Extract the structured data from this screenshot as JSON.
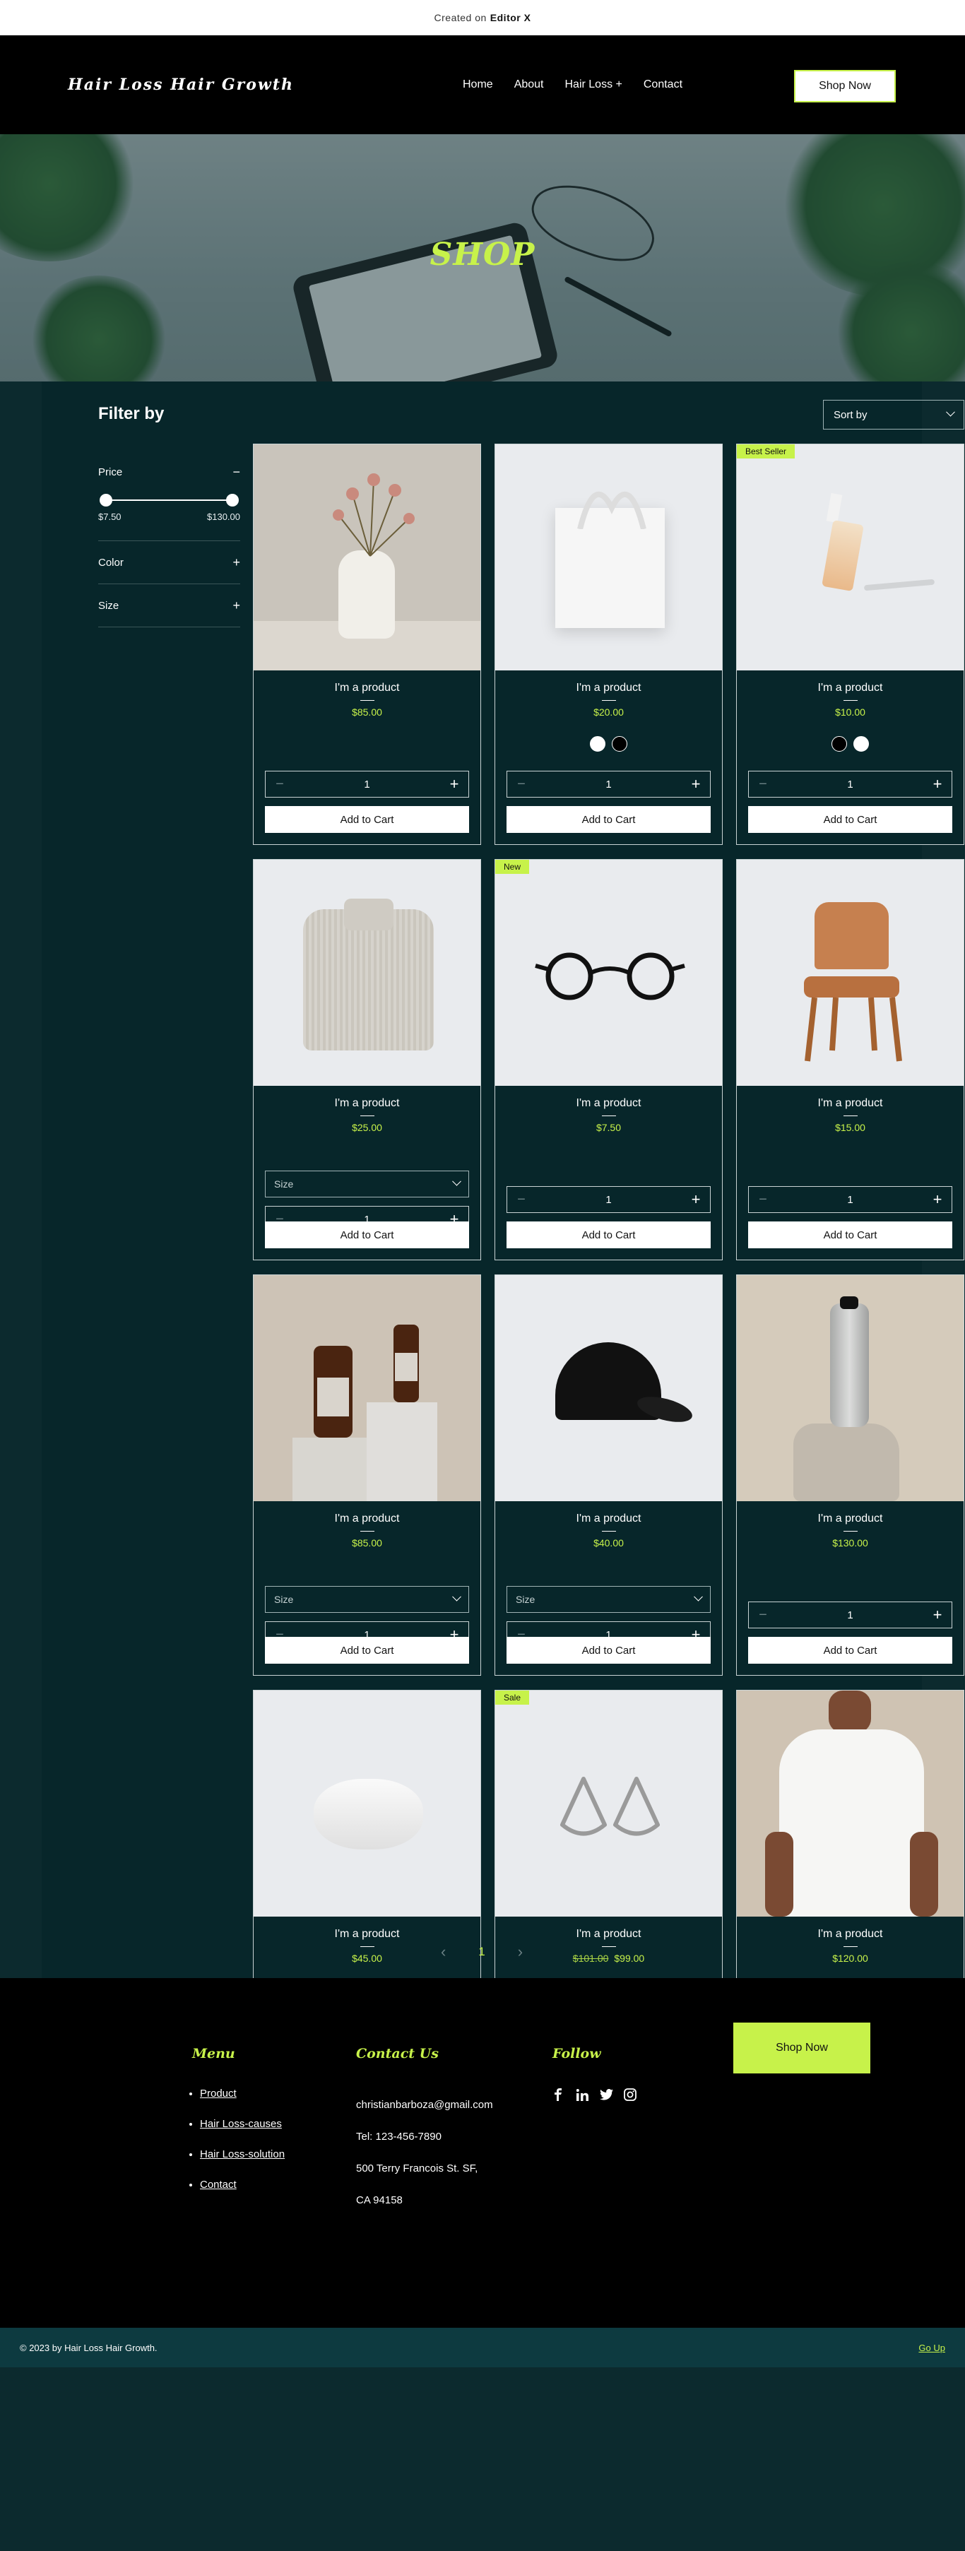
{
  "banner": {
    "prefix": "Created on",
    "brand": "Editor X"
  },
  "header": {
    "logo": "Hair Loss Hair Growth",
    "nav": [
      "Home",
      "About",
      "Hair Loss +",
      "Contact"
    ],
    "cta": "Shop Now"
  },
  "hero": {
    "title": "SHOP"
  },
  "filters": {
    "title": "Filter by",
    "price": {
      "label": "Price",
      "min": "$7.50",
      "max": "$130.00",
      "toggle": "−"
    },
    "color": {
      "label": "Color",
      "toggle": "+"
    },
    "size": {
      "label": "Size",
      "toggle": "+"
    }
  },
  "sort": {
    "label": "Sort by"
  },
  "product_common": {
    "qty": "1",
    "add_to_cart": "Add to Cart",
    "size_placeholder": "Size"
  },
  "products": [
    {
      "name": "I'm a product",
      "price": "$85.00",
      "ribbon": "",
      "variant": "none",
      "image": "vase-flowers"
    },
    {
      "name": "I'm a product",
      "price": "$20.00",
      "ribbon": "",
      "variant": "color",
      "image": "tote-bag",
      "swatches": [
        "#ffffff",
        "#000000"
      ]
    },
    {
      "name": "I'm a product",
      "price": "$10.00",
      "ribbon": "Best Seller",
      "variant": "color",
      "image": "serum-bottle",
      "swatches": [
        "#000000",
        "#ffffff"
      ]
    },
    {
      "name": "I'm a product",
      "price": "$25.00",
      "ribbon": "",
      "variant": "size",
      "image": "knit-sweater"
    },
    {
      "name": "I'm a product",
      "price": "$7.50",
      "ribbon": "New",
      "variant": "none",
      "image": "eyeglasses"
    },
    {
      "name": "I'm a product",
      "price": "$15.00",
      "ribbon": "",
      "variant": "none",
      "image": "wooden-chair"
    },
    {
      "name": "I'm a product",
      "price": "$85.00",
      "ribbon": "",
      "variant": "size",
      "image": "pump-bottles"
    },
    {
      "name": "I'm a product",
      "price": "$40.00",
      "ribbon": "",
      "variant": "size",
      "image": "black-cap"
    },
    {
      "name": "I'm a product",
      "price": "$130.00",
      "ribbon": "",
      "variant": "none",
      "image": "water-bottle"
    },
    {
      "name": "I'm a product",
      "price": "$45.00",
      "ribbon": "",
      "variant": "none",
      "image": "soap-bar"
    },
    {
      "name": "I'm a product",
      "price": "$99.00",
      "old_price": "$101.00",
      "ribbon": "Sale",
      "variant": "none",
      "image": "earrings"
    },
    {
      "name": "I'm a product",
      "price": "$120.00",
      "ribbon": "",
      "variant": "size",
      "image": "white-tshirt"
    }
  ],
  "pagination": {
    "prev": "‹",
    "current": "1",
    "next": "›"
  },
  "footer": {
    "menu_title": "Menu",
    "menu": [
      "Product",
      "Hair Loss-causes",
      "Hair Loss-solution",
      "Contact"
    ],
    "contact_title": "Contact Us",
    "contact": [
      "christianbarboza@gmail.com",
      "Tel: 123-456-7890",
      "500 Terry Francois St. SF,",
      "CA 94158"
    ],
    "follow_title": "Follow",
    "social": [
      "f",
      "in",
      "t",
      "ig"
    ],
    "cta": "Shop Now",
    "copyright": "© 2023 by Hair Loss Hair Growth.",
    "go_up": "Go Up"
  },
  "colors": {
    "accent": "#c7f24a",
    "bg": "#07262a",
    "footer": "#000000",
    "bottom_bar": "#0d3a40"
  }
}
